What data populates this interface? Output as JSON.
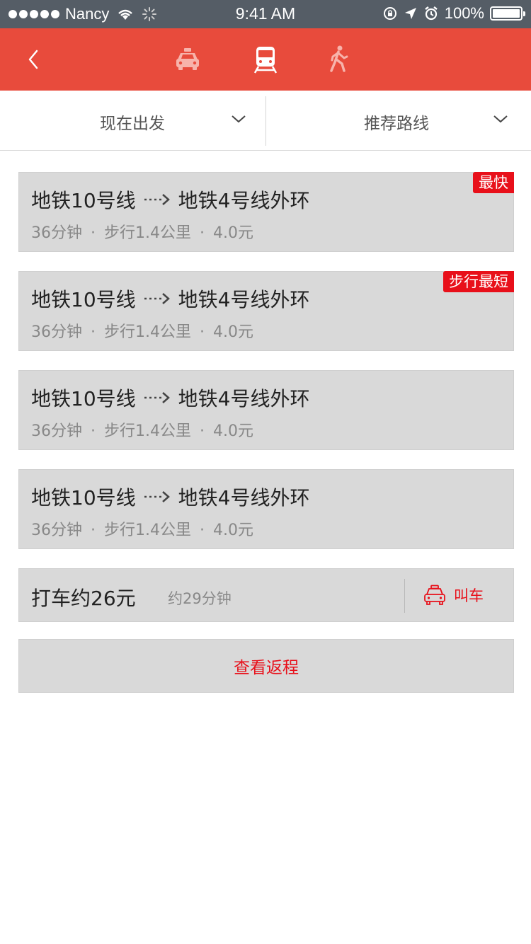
{
  "status_bar": {
    "carrier": "Nancy",
    "time": "9:41 AM",
    "battery": "100%"
  },
  "nav": {
    "modes": [
      "taxi-icon",
      "subway-icon",
      "walk-icon"
    ],
    "selected_mode": "subway-icon"
  },
  "filters": {
    "depart_label": "现在出发",
    "route_label": "推荐路线"
  },
  "routes": [
    {
      "from": "地铁10号线",
      "to": "地铁4号线外环",
      "duration": "36分钟",
      "walk": "步行1.4公里",
      "fare": "4.0元",
      "badge": "最快"
    },
    {
      "from": "地铁10号线",
      "to": "地铁4号线外环",
      "duration": "36分钟",
      "walk": "步行1.4公里",
      "fare": "4.0元",
      "badge": "步行最短"
    },
    {
      "from": "地铁10号线",
      "to": "地铁4号线外环",
      "duration": "36分钟",
      "walk": "步行1.4公里",
      "fare": "4.0元",
      "badge": ""
    },
    {
      "from": "地铁10号线",
      "to": "地铁4号线外环",
      "duration": "36分钟",
      "walk": "步行1.4公里",
      "fare": "4.0元",
      "badge": ""
    }
  ],
  "taxi": {
    "price": "打车约26元",
    "time": "约29分钟",
    "call_label": "叫车"
  },
  "return_label": "查看返程",
  "colors": {
    "status_bar": "#555d66",
    "nav_bar": "#e84b3c",
    "accent_red": "#e8101a",
    "card_bg": "#d9d9d9"
  }
}
